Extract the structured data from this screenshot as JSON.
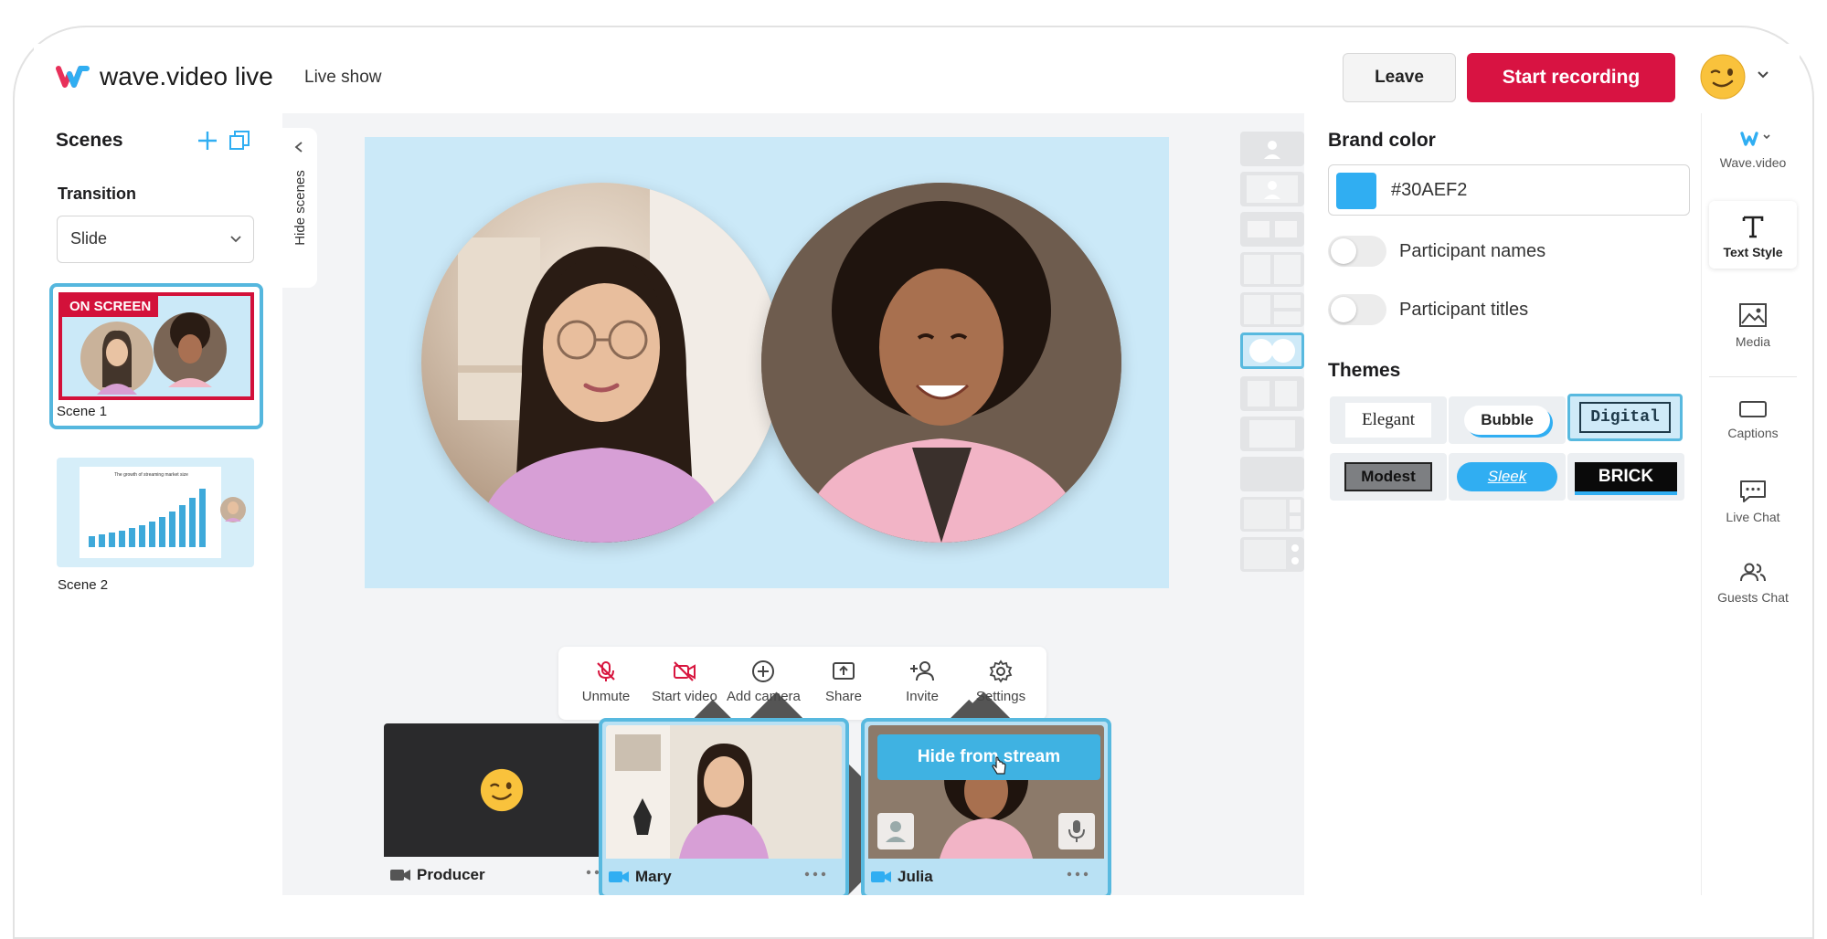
{
  "header": {
    "logo_text": "wave.video live",
    "show_title": "Live show",
    "leave_label": "Leave",
    "record_label": "Start recording"
  },
  "scenes_panel": {
    "title": "Scenes",
    "transition_label": "Transition",
    "transition_value": "Slide",
    "hide_scenes_label": "Hide scenes",
    "scenes": [
      {
        "label": "Scene 1",
        "badge": "ON SCREEN"
      },
      {
        "label": "Scene 2",
        "chart_title": "The growth of streaming market size"
      }
    ]
  },
  "toolbar": {
    "unmute": "Unmute",
    "start_video": "Start video",
    "add_camera": "Add camera",
    "share": "Share",
    "invite": "Invite",
    "settings": "Settings"
  },
  "participants": [
    {
      "name": "Producer"
    },
    {
      "name": "Mary"
    },
    {
      "name": "Julia",
      "overlay_button": "Hide from stream"
    }
  ],
  "brand_panel": {
    "brand_color_label": "Brand color",
    "brand_color_value": "#30AEF2",
    "participant_names_label": "Participant names",
    "participant_titles_label": "Participant titles",
    "themes_label": "Themes",
    "themes": [
      "Elegant",
      "Bubble",
      "Digital",
      "Modest",
      "Sleek",
      "BRICK"
    ],
    "selected_theme": "Digital"
  },
  "sidebar": {
    "items": [
      "Wave.video",
      "Text Style",
      "Media",
      "Captions",
      "Live Chat",
      "Guests Chat"
    ],
    "active": "Text Style"
  },
  "colors": {
    "accent": "#30AEF2",
    "record": "#D81342",
    "stage_bg": "#CBE9F8"
  }
}
